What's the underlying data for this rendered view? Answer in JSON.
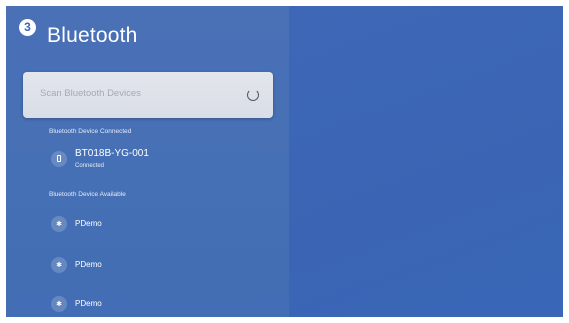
{
  "header": {
    "step_number": "3",
    "title": "Bluetooth"
  },
  "scan": {
    "label": "Scan Bluetooth Devices",
    "icon": "spinner-icon"
  },
  "connected_section": {
    "heading": "Bluetooth Device Connected",
    "devices": [
      {
        "name": "BT018B-YG-001",
        "status": "Connected",
        "icon": "phone-icon"
      }
    ]
  },
  "available_section": {
    "heading": "Bluetooth Device Available",
    "devices": [
      {
        "name": "PDemo",
        "icon": "bluetooth-icon"
      },
      {
        "name": "PDemo",
        "icon": "bluetooth-icon"
      },
      {
        "name": "PDemo",
        "icon": "bluetooth-icon"
      }
    ]
  }
}
